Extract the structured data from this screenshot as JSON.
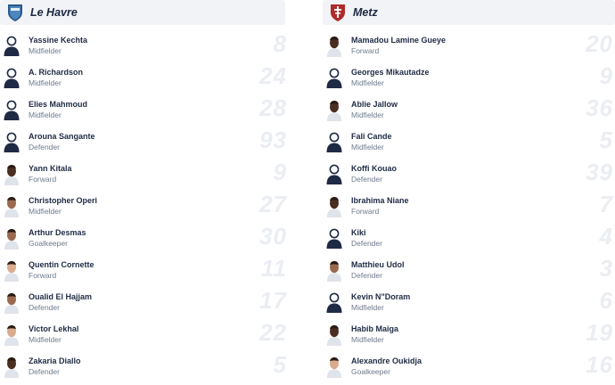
{
  "home": {
    "team": "Le Havre",
    "players": [
      {
        "name": "Yassine Kechta",
        "position": "Midfielder",
        "number": "8",
        "avatar": "silhouette"
      },
      {
        "name": "A. Richardson",
        "position": "Midfielder",
        "number": "24",
        "avatar": "silhouette"
      },
      {
        "name": "Elies Mahmoud",
        "position": "Midfielder",
        "number": "28",
        "avatar": "silhouette"
      },
      {
        "name": "Arouna Sangante",
        "position": "Defender",
        "number": "93",
        "avatar": "silhouette"
      },
      {
        "name": "Yann Kitala",
        "position": "Forward",
        "number": "9",
        "avatar": "photo-dark"
      },
      {
        "name": "Christopher Operi",
        "position": "Midfielder",
        "number": "27",
        "avatar": "photo-medium"
      },
      {
        "name": "Arthur Desmas",
        "position": "Goalkeeper",
        "number": "30",
        "avatar": "photo-medium"
      },
      {
        "name": "Quentin Cornette",
        "position": "Forward",
        "number": "11",
        "avatar": "photo-light"
      },
      {
        "name": "Oualid El Hajjam",
        "position": "Defender",
        "number": "17",
        "avatar": "photo-medium"
      },
      {
        "name": "Victor Lekhal",
        "position": "Midfielder",
        "number": "22",
        "avatar": "photo-light"
      },
      {
        "name": "Zakaria Diallo",
        "position": "Defender",
        "number": "5",
        "avatar": "photo-dark"
      }
    ]
  },
  "away": {
    "team": "Metz",
    "players": [
      {
        "name": "Mamadou Lamine Gueye",
        "position": "Forward",
        "number": "20",
        "avatar": "photo-dark"
      },
      {
        "name": "Georges Mikautadze",
        "position": "Midfielder",
        "number": "9",
        "avatar": "silhouette"
      },
      {
        "name": "Ablie Jallow",
        "position": "Midfielder",
        "number": "36",
        "avatar": "photo-dark"
      },
      {
        "name": "Fali Cande",
        "position": "Midfielder",
        "number": "5",
        "avatar": "silhouette"
      },
      {
        "name": "Koffi Kouao",
        "position": "Defender",
        "number": "39",
        "avatar": "silhouette"
      },
      {
        "name": "Ibrahima Niane",
        "position": "Forward",
        "number": "7",
        "avatar": "photo-dark"
      },
      {
        "name": "Kiki",
        "position": "Defender",
        "number": "4",
        "avatar": "silhouette"
      },
      {
        "name": "Matthieu Udol",
        "position": "Defender",
        "number": "3",
        "avatar": "photo-medium"
      },
      {
        "name": "Kevin N\"Doram",
        "position": "Midfielder",
        "number": "6",
        "avatar": "silhouette"
      },
      {
        "name": "Habib Maiga",
        "position": "Midfielder",
        "number": "19",
        "avatar": "photo-dark"
      },
      {
        "name": "Alexandre Oukidja",
        "position": "Goalkeeper",
        "number": "16",
        "avatar": "photo-light"
      }
    ]
  },
  "colors": {
    "le_havre_crest": "#2a5a8c",
    "metz_crest": "#b02a2a",
    "silhouette": "#1f2a44",
    "shirt_number": "#eaedf2"
  }
}
